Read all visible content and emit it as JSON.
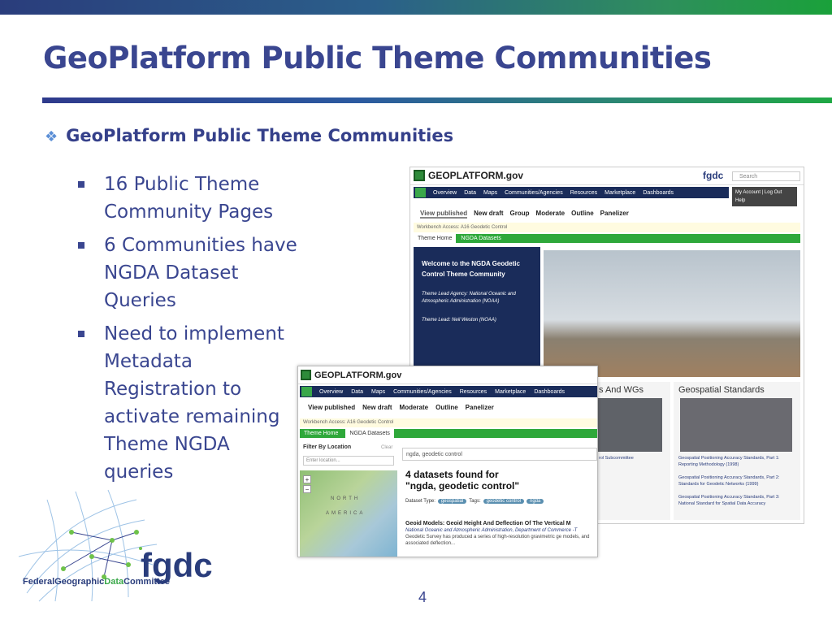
{
  "slide": {
    "title": "GeoPlatform Public Theme Communities",
    "subtitle": "GeoPlatform Public Theme Communities",
    "bullets": [
      "16 Public Theme Community Pages",
      "6 Communities have NGDA Dataset Queries",
      "Need to implement Metadata Registration to activate remaining Theme NGDA queries"
    ],
    "page_number": "4",
    "logo": {
      "name": "fgdc",
      "text_a": "Federal",
      "text_b": "Geographic",
      "text_c": "Data",
      "text_d": "Committee"
    }
  },
  "shot1": {
    "brand": "GEOPLATFORM.gov",
    "fgdc": "fgdc",
    "search_placeholder": "Search",
    "nav": [
      "Overview",
      "Data",
      "Maps",
      "Communities/Agencies",
      "Resources",
      "Marketplace",
      "Dashboards"
    ],
    "login": [
      "My Account",
      "Log Out",
      "Help"
    ],
    "tabs": [
      "View published",
      "New draft",
      "Group",
      "Moderate",
      "Outline",
      "Panelizer"
    ],
    "workbench": "Workbench Access: A16 Geodetic Control",
    "theme_tabs": [
      "Theme Home",
      "NGDA Datasets"
    ],
    "welcome": "Welcome to the NGDA Geodetic Control Theme Community",
    "lead_agency": "Theme Lead Agency: National Oceanic and Atmospheric Administration (NOAA)",
    "lead": "Theme Lead: Neil Weston (NOAA)",
    "card_a_title": "s And WGs",
    "card_a_text": "rol Subcommittee",
    "card_b_title": "Geospatial Standards",
    "card_b_items": [
      "Geospatial Positioning Accuracy Standards, Part 1: Reporting Methodology (1998)",
      "Geospatial Positioning Accuracy Standards, Part 2: Standards for Geodetic Networks (1999)",
      "Geospatial Positioning Accuracy Standards, Part 3: National Standard for Spatial Data Accuracy"
    ]
  },
  "shot2": {
    "brand": "GEOPLATFORM.gov",
    "nav": [
      "Overview",
      "Data",
      "Maps",
      "Communities/Agencies",
      "Resources",
      "Marketplace",
      "Dashboards"
    ],
    "tabs": [
      "View published",
      "New draft",
      "Moderate",
      "Outline",
      "Panelizer"
    ],
    "workbench": "Workbench Access: A16 Geodetic Control",
    "theme_tabs": [
      "Theme Home",
      "NGDA Datasets"
    ],
    "filter_label": "Filter By Location",
    "clear": "Clear",
    "location_placeholder": "Enter location...",
    "map_labels": [
      "NORTH",
      "AMERICA"
    ],
    "query": "ngda, geodetic control",
    "found_line1": "4 datasets found for",
    "found_line2": "\"ngda, geodetic control\"",
    "dataset_type_label": "Dataset Type:",
    "dataset_type": "geospatial",
    "tags_label": "Tags:",
    "tags": [
      "geodetic control",
      "ngda"
    ],
    "result_title": "Geoid Models: Geoid Height And Deflection Of The Vertical M",
    "result_source": "National Oceanic and Atmospheric Administration, Department of Commerce -T",
    "result_desc": "Geodetic Survey has produced a series of high-resolution gravimetric ge models, and associated deflection..."
  }
}
